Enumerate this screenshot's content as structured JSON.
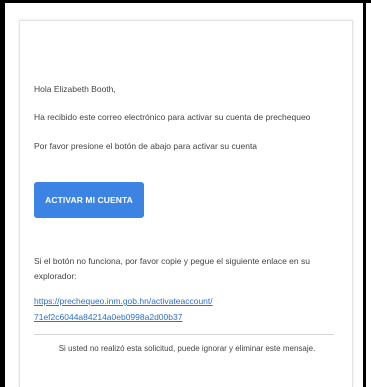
{
  "email": {
    "greeting": "Hola Elizabeth Booth,",
    "intro": "Ha recibido este correo electrónico para activar su cuenta de prechequeo",
    "instruction": "Por favor presione el botón de abajo para activar su cuenta",
    "button_label": "ACTIVAR MI CUENTA",
    "fallback_text": "Si el botón no funciona, por favor copie y pegue el siguiente enlace en su explorador:",
    "link_line1": "https://prechequeo.inm.gob.hn/activateaccount/",
    "link_line2": "71ef2c6044a84214a0eb0998a2d00b37",
    "footer_note": "Si usted no realizó esta solicitud, puede ignorar y eliminar este mensaje."
  },
  "colors": {
    "button_bg": "#3b84e4",
    "link": "#2c6fcc",
    "text": "#444444"
  }
}
